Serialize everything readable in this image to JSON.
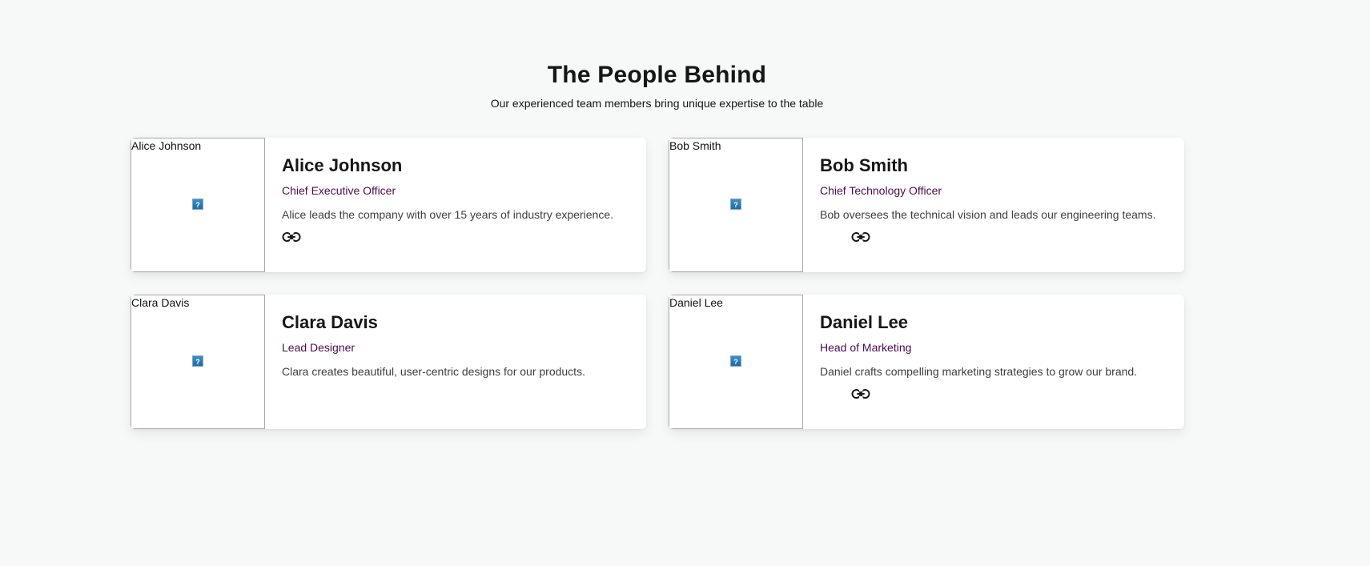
{
  "header": {
    "title": "The People Behind",
    "subtitle": "Our experienced team members bring unique expertise to the table"
  },
  "colors": {
    "background": "#f7f8f8",
    "card": "#ffffff",
    "role_text": "#4e0a4e",
    "heading": "#161616",
    "body_text": "#3e3e3e"
  },
  "team": [
    {
      "photo_alt": "Alice Johnson",
      "name": "Alice Johnson",
      "role": "Chief Executive Officer",
      "bio": "Alice leads the company with over 15 years of industry experience.",
      "link_icon": "link-icon"
    },
    {
      "photo_alt": "Bob Smith",
      "name": "Bob Smith",
      "role": "Chief Technology Officer",
      "bio": "Bob oversees the technical vision and leads our engineering teams.",
      "link_icon": "link-icon"
    },
    {
      "photo_alt": "Clara Davis",
      "name": "Clara Davis",
      "role": "Lead Designer",
      "bio": "Clara creates beautiful, user-centric designs for our products."
    },
    {
      "photo_alt": "Daniel Lee",
      "name": "Daniel Lee",
      "role": "Head of Marketing",
      "bio": "Daniel crafts compelling marketing strategies to grow our brand.",
      "link_icon": "link-icon"
    }
  ]
}
